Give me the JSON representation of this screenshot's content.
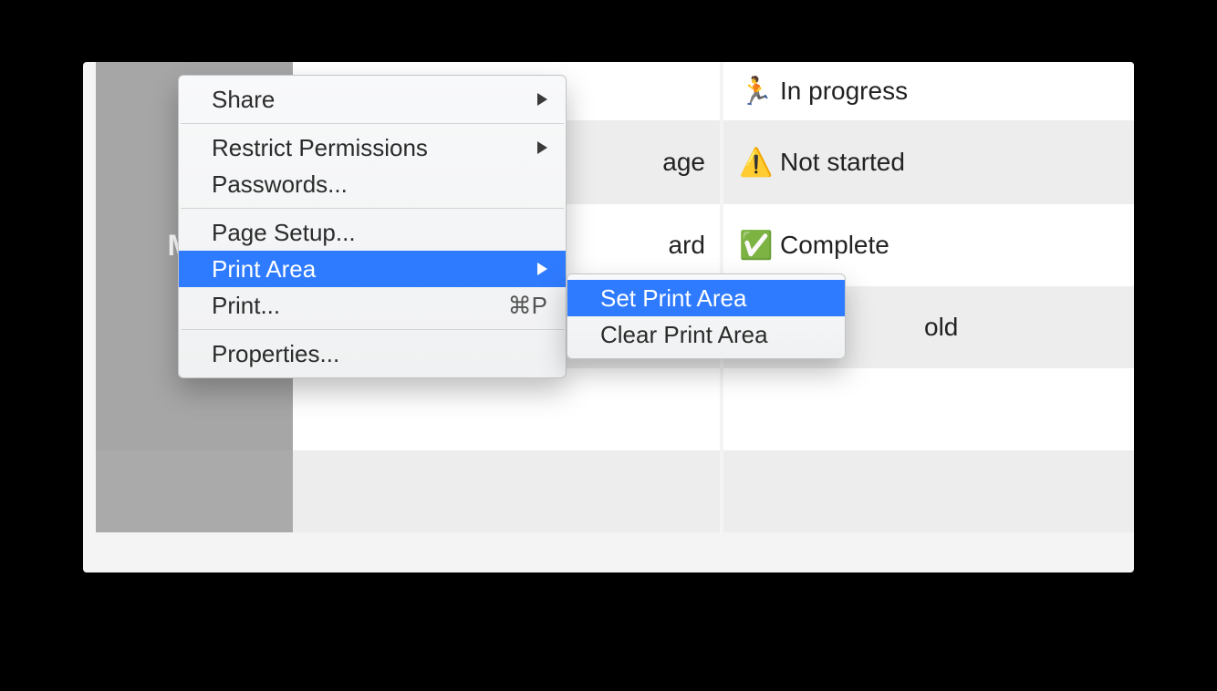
{
  "row_header": "Mor",
  "cells": {
    "r1": {
      "b_icon": "🏃",
      "b_text": "In progress"
    },
    "r2": {
      "a_text": "age",
      "b_icon": "⚠️",
      "b_text": "Not started"
    },
    "r3": {
      "a_text": "ard",
      "b_icon": "✅",
      "b_text": "Complete"
    },
    "r4": {
      "b_text_frag": "old"
    }
  },
  "menu": {
    "share": "Share",
    "restrict": "Restrict Permissions",
    "passwords": "Passwords...",
    "page_setup": "Page Setup...",
    "print_area": "Print Area",
    "print": "Print...",
    "print_accel": "⌘P",
    "properties": "Properties..."
  },
  "submenu": {
    "set": "Set Print Area",
    "clear": "Clear Print Area"
  }
}
